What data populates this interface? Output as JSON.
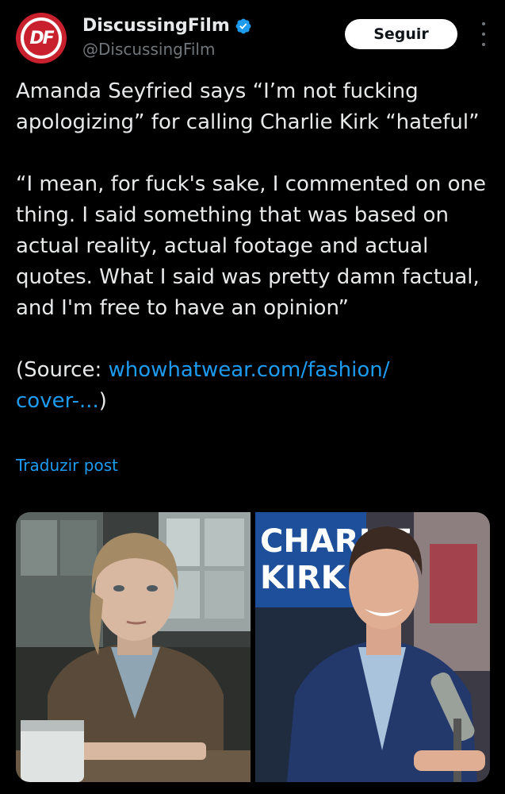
{
  "account": {
    "display_name": "DiscussingFilm",
    "handle": "@DiscussingFilm",
    "avatar_logo": "DF",
    "verified_color": "#1d9bf0"
  },
  "header": {
    "follow_label": "Seguir",
    "more_icon": "more-vertical-icon"
  },
  "post": {
    "text": "Amanda Seyfried says “I’m not fucking apologizing” for calling Charlie Kirk “hateful”\n\n“I mean, for fuck's sake, I commented on one thing. I said something that was based on actual reality, actual footage and actual quotes. What I said was pretty damn factual, and I'm free to have an opinion”\n\n(Source: ",
    "link_text": "whowhatwear.com/fashion/\ncover-...",
    "after_link": ")",
    "translate_label": "Traduzir post"
  },
  "media": {
    "right_sign_line1": "CHARLIE",
    "right_sign_line2": "KIRK"
  },
  "colors": {
    "background": "#000000",
    "text": "#e7e9ea",
    "secondary_text": "#71767b",
    "link": "#1d9bf0",
    "brand_red": "#c8202c"
  }
}
